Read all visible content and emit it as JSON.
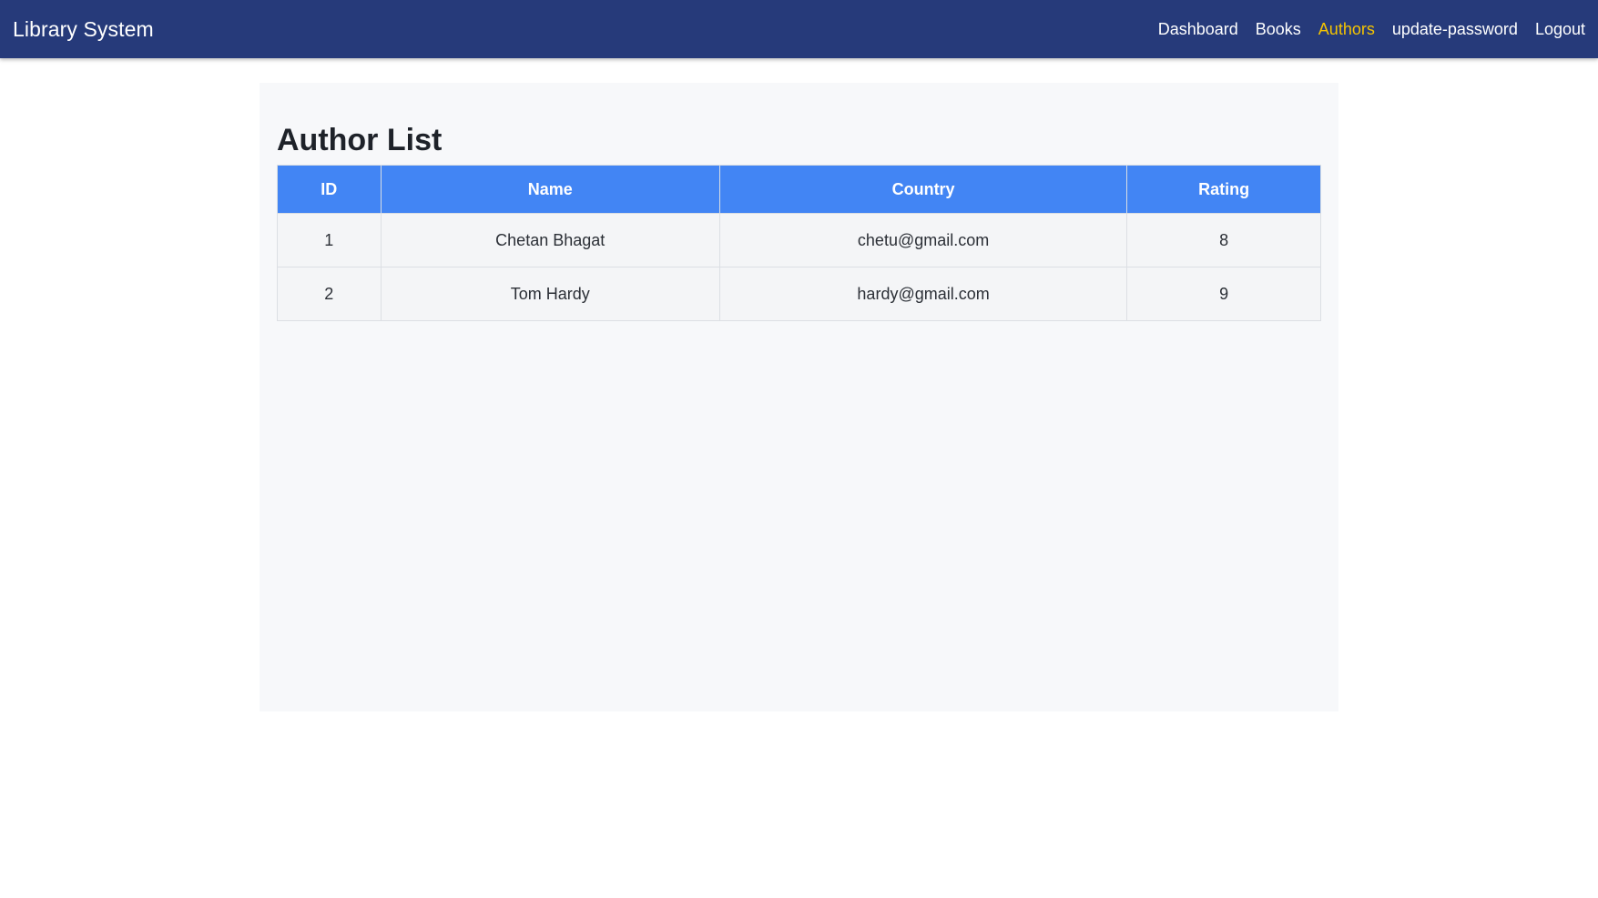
{
  "navbar": {
    "brand": "Library System",
    "links": [
      {
        "label": "Dashboard",
        "active": false
      },
      {
        "label": "Books",
        "active": false
      },
      {
        "label": "Authors",
        "active": true
      },
      {
        "label": "update-password",
        "active": false
      },
      {
        "label": "Logout",
        "active": false
      }
    ]
  },
  "main": {
    "title": "Author List",
    "table": {
      "headers": [
        "ID",
        "Name",
        "Country",
        "Rating"
      ],
      "rows": [
        [
          "1",
          "Chetan Bhagat",
          "chetu@gmail.com",
          "8"
        ],
        [
          "2",
          "Tom Hardy",
          "hardy@gmail.com",
          "9"
        ]
      ]
    }
  },
  "colors": {
    "navbar_bg": "#263a7a",
    "active_link": "#f5c400",
    "table_header_bg": "#4285f4",
    "card_bg": "#f7f8fa"
  }
}
